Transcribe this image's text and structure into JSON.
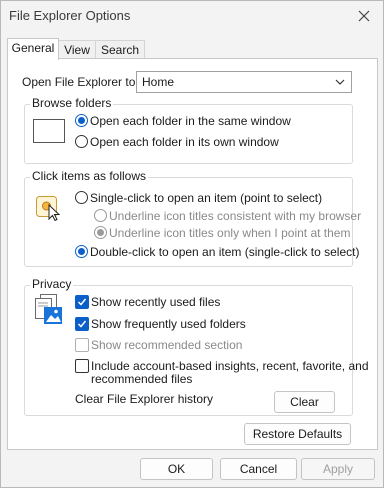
{
  "window": {
    "title": "File Explorer Options"
  },
  "tabs": [
    {
      "label": "General",
      "active": true
    },
    {
      "label": "View",
      "active": false
    },
    {
      "label": "Search",
      "active": false
    }
  ],
  "open_explorer": {
    "label": "Open File Explorer to:",
    "value": "Home"
  },
  "browse_folders": {
    "title": "Browse folders",
    "options": [
      {
        "label": "Open each folder in the same window",
        "checked": true
      },
      {
        "label": "Open each folder in its own window",
        "checked": false
      }
    ]
  },
  "click_items": {
    "title": "Click items as follows",
    "single_click": {
      "label": "Single-click to open an item (point to select)",
      "checked": false
    },
    "sub_options": [
      {
        "label": "Underline icon titles consistent with my browser",
        "checked": false
      },
      {
        "label": "Underline icon titles only when I point at them",
        "checked": true
      }
    ],
    "double_click": {
      "label": "Double-click to open an item (single-click to select)",
      "checked": true
    }
  },
  "privacy": {
    "title": "Privacy",
    "options": [
      {
        "label": "Show recently used files",
        "checked": true,
        "enabled": true
      },
      {
        "label": "Show frequently used folders",
        "checked": true,
        "enabled": true
      },
      {
        "label": "Show recommended section",
        "checked": false,
        "enabled": false
      }
    ],
    "insights": {
      "line1": "Include account-based insights, recent, favorite, and",
      "line2": "recommended files",
      "checked": false
    },
    "clear_label": "Clear File Explorer history",
    "clear_button": "Clear"
  },
  "restore_defaults": "Restore Defaults",
  "footer": {
    "ok": "OK",
    "cancel": "Cancel",
    "apply": "Apply"
  },
  "colors": {
    "accent": "#0a60c8"
  }
}
